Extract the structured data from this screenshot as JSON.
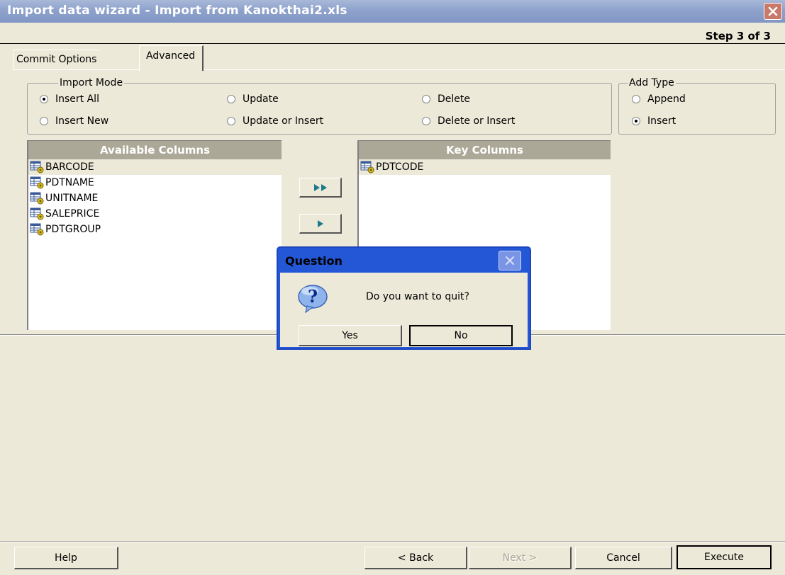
{
  "window": {
    "title": "Import data wizard - Import from Kanokthai2.xls",
    "step": "Step 3 of 3"
  },
  "tabs": [
    {
      "label": "Commit Options"
    },
    {
      "label": "Advanced"
    }
  ],
  "import_mode": {
    "label": "Import Mode",
    "options": [
      {
        "label": "Insert All",
        "selected": true
      },
      {
        "label": "Insert New",
        "selected": false
      },
      {
        "label": "Update",
        "selected": false
      },
      {
        "label": "Update or Insert",
        "selected": false
      },
      {
        "label": "Delete",
        "selected": false
      },
      {
        "label": "Delete or Insert",
        "selected": false
      }
    ]
  },
  "add_type": {
    "label": "Add Type",
    "options": [
      {
        "label": "Append",
        "selected": false
      },
      {
        "label": "Insert",
        "selected": true
      }
    ]
  },
  "available_columns": {
    "header": "Available Columns",
    "items": [
      {
        "label": "BARCODE"
      },
      {
        "label": "PDTNAME"
      },
      {
        "label": "UNITNAME"
      },
      {
        "label": "SALEPRICE"
      },
      {
        "label": "PDTGROUP"
      }
    ]
  },
  "key_columns": {
    "header": "Key Columns",
    "items": [
      {
        "label": "PDTCODE"
      }
    ]
  },
  "footer": {
    "help": "Help",
    "back": "< Back",
    "next": "Next >",
    "cancel": "Cancel",
    "execute": "Execute"
  },
  "dialog": {
    "title": "Question",
    "message": "Do you want to quit?",
    "yes": "Yes",
    "no": "No"
  },
  "colors": {
    "title_bar": "#8ea2cc",
    "dialog_frame": "#2457d6",
    "list_header": "#aca898",
    "face": "#ece9d8"
  }
}
